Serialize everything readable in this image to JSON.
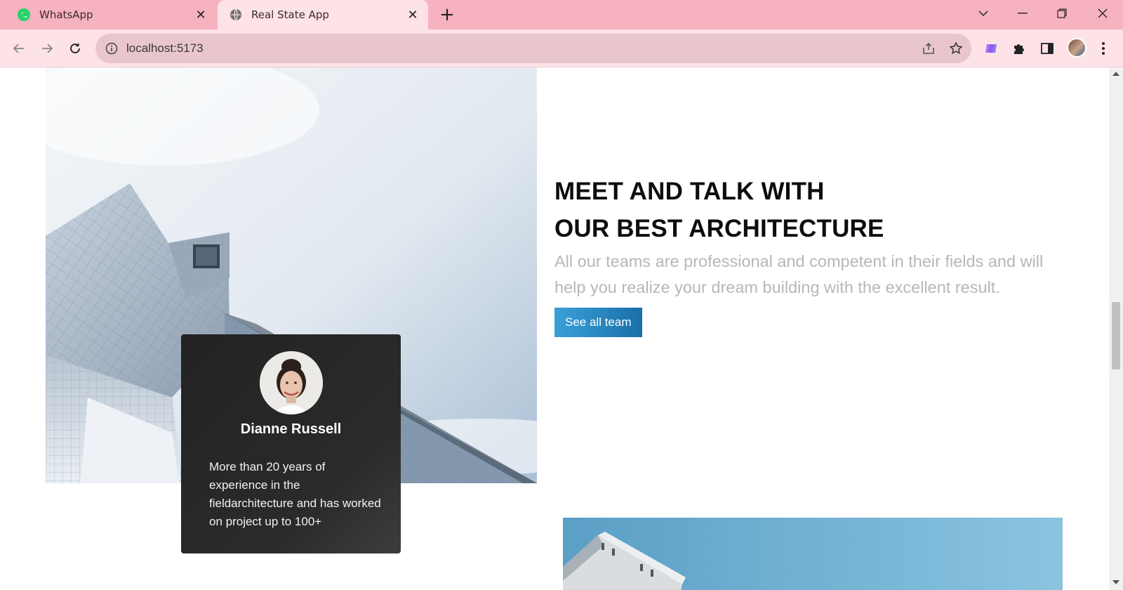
{
  "browser": {
    "tabs": [
      {
        "title": "WhatsApp",
        "favicon": "whatsapp-icon",
        "active": false
      },
      {
        "title": "Real State App",
        "favicon": "globe-icon",
        "active": true
      }
    ],
    "url": "localhost:5173"
  },
  "section": {
    "headline_line1": "MEET AND TALK WITH",
    "headline_line2": "OUR BEST ARCHITECTURE",
    "description": "All our teams are professional and competent in their fields and will help you realize your dream building with the excellent result.",
    "cta_label": "See all team"
  },
  "team_card": {
    "name": "Dianne Russell",
    "bio": "More than 20 years of experience in the fieldarchitecture and has worked on project up to 100+"
  },
  "colors": {
    "tabbar": "#f7b2c0",
    "toolbar": "#fde2e8",
    "accent": "#2a8ac6",
    "card": "#222222"
  }
}
